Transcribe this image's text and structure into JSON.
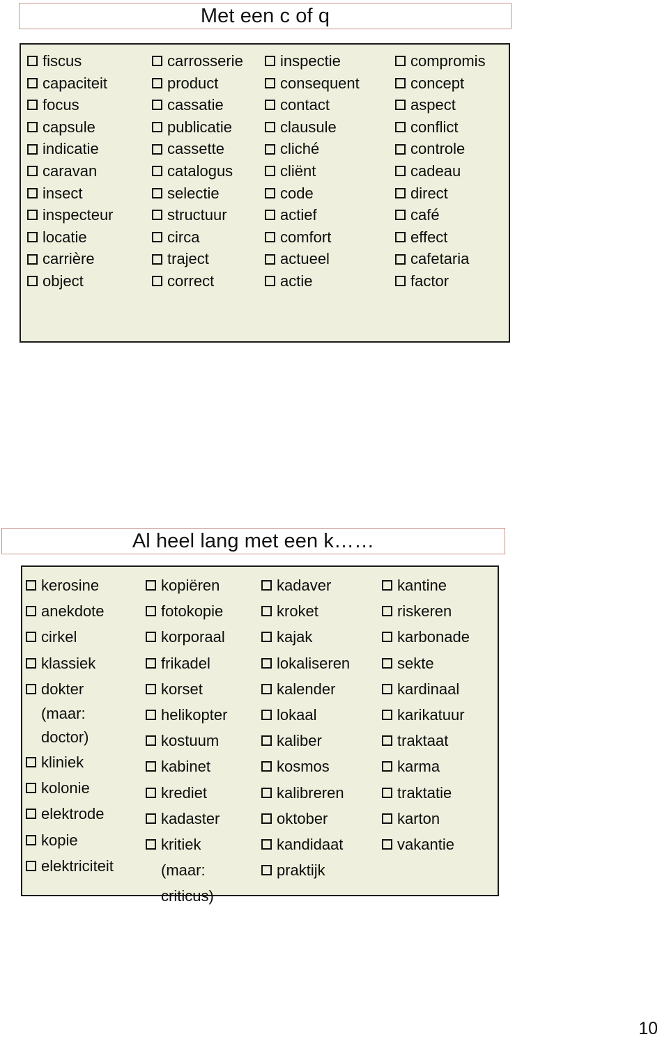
{
  "page": {
    "number": "10"
  },
  "sections": [
    {
      "title": "Met een c of q",
      "columns": [
        {
          "items": [
            {
              "label": "fiscus"
            },
            {
              "label": "capaciteit"
            },
            {
              "label": "focus"
            },
            {
              "label": "capsule"
            },
            {
              "label": "indicatie"
            },
            {
              "label": "caravan"
            },
            {
              "label": "insect"
            },
            {
              "label": "inspecteur"
            },
            {
              "label": "locatie"
            },
            {
              "label": "carrière"
            },
            {
              "label": "object"
            }
          ]
        },
        {
          "items": [
            {
              "label": "carrosserie"
            },
            {
              "label": "product"
            },
            {
              "label": "cassatie"
            },
            {
              "label": "publicatie"
            },
            {
              "label": "cassette"
            },
            {
              "label": "catalogus"
            },
            {
              "label": "selectie"
            },
            {
              "label": "structuur"
            },
            {
              "label": "circa"
            },
            {
              "label": "traject"
            },
            {
              "label": "correct"
            }
          ]
        },
        {
          "items": [
            {
              "label": "inspectie"
            },
            {
              "label": "consequent"
            },
            {
              "label": "contact"
            },
            {
              "label": "clausule"
            },
            {
              "label": "cliché"
            },
            {
              "label": "cliënt"
            },
            {
              "label": "code"
            },
            {
              "label": "actief"
            },
            {
              "label": "comfort"
            },
            {
              "label": "actueel"
            },
            {
              "label": "actie"
            }
          ]
        },
        {
          "items": [
            {
              "label": "compromis"
            },
            {
              "label": "concept"
            },
            {
              "label": "aspect"
            },
            {
              "label": "conflict"
            },
            {
              "label": "controle"
            },
            {
              "label": "cadeau"
            },
            {
              "label": "direct"
            },
            {
              "label": "café"
            },
            {
              "label": "effect"
            },
            {
              "label": "cafetaria"
            },
            {
              "label": "factor"
            }
          ]
        }
      ]
    },
    {
      "title": "Al heel lang met een k……",
      "columns": [
        {
          "items": [
            {
              "label": "kerosine"
            },
            {
              "label": "anekdote"
            },
            {
              "label": "cirkel"
            },
            {
              "label": "klassiek"
            },
            {
              "label": "dokter",
              "notes": [
                "(maar:",
                "doctor)"
              ]
            },
            {
              "label": "kliniek"
            },
            {
              "label": "kolonie"
            },
            {
              "label": "elektrode"
            },
            {
              "label": "kopie"
            },
            {
              "label": "elektriciteit"
            }
          ]
        },
        {
          "items": [
            {
              "label": "kopiëren"
            },
            {
              "label": "fotokopie"
            },
            {
              "label": "korporaal"
            },
            {
              "label": "frikadel"
            },
            {
              "label": "korset"
            },
            {
              "label": "helikopter"
            },
            {
              "label": "kostuum"
            },
            {
              "label": "kabinet"
            },
            {
              "label": "krediet"
            },
            {
              "label": "kadaster"
            },
            {
              "label": "kritiek",
              "notes": [
                "(maar:",
                "criticus)"
              ]
            }
          ]
        },
        {
          "items": [
            {
              "label": "kadaver"
            },
            {
              "label": "kroket"
            },
            {
              "label": "kajak"
            },
            {
              "label": "lokaliseren"
            },
            {
              "label": "kalender"
            },
            {
              "label": "lokaal"
            },
            {
              "label": "kaliber"
            },
            {
              "label": "kosmos"
            },
            {
              "label": "kalibreren"
            },
            {
              "label": "oktober"
            },
            {
              "label": "kandidaat"
            },
            {
              "label": "praktijk"
            }
          ]
        },
        {
          "items": [
            {
              "label": "kantine"
            },
            {
              "label": "riskeren"
            },
            {
              "label": "karbonade"
            },
            {
              "label": "sekte"
            },
            {
              "label": "kardinaal"
            },
            {
              "label": "karikatuur"
            },
            {
              "label": "traktaat"
            },
            {
              "label": "karma"
            },
            {
              "label": "traktatie"
            },
            {
              "label": "karton"
            },
            {
              "label": "vakantie"
            }
          ]
        }
      ]
    }
  ],
  "colors": {
    "table_background": "#eef0dd",
    "table_border": "#1a1a1a",
    "title_border": "#c8938b",
    "text": "#111111"
  }
}
